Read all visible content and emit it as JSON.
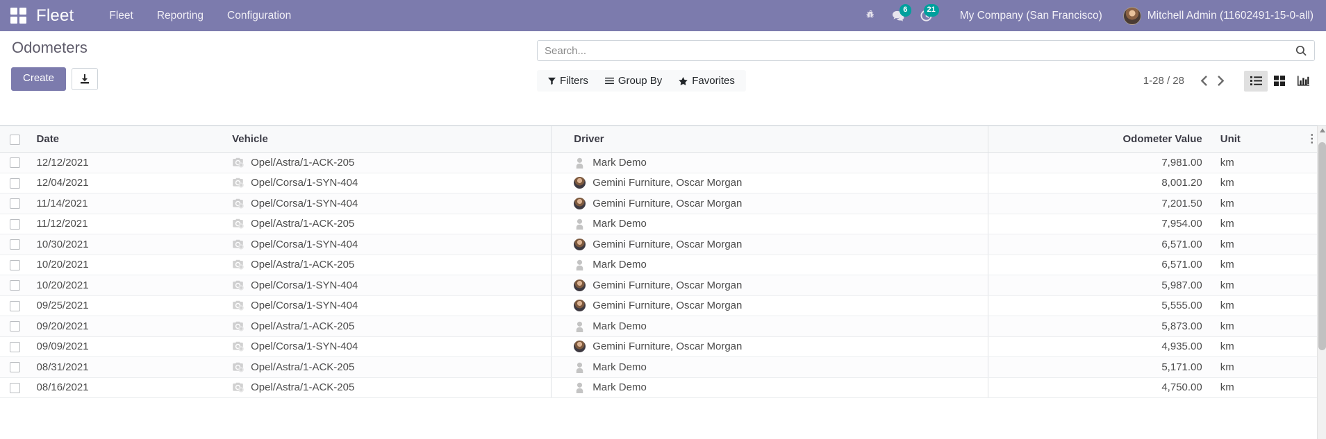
{
  "navbar": {
    "apps_icon": "apps-grid-icon",
    "brand": "Fleet",
    "menus": [
      {
        "label": "Fleet"
      },
      {
        "label": "Reporting"
      },
      {
        "label": "Configuration"
      }
    ],
    "sys_icons": [
      {
        "name": "bug-icon",
        "badge": null
      },
      {
        "name": "messages-icon",
        "badge": "6"
      },
      {
        "name": "activities-clock-icon",
        "badge": "21"
      }
    ],
    "company": "My Company (San Francisco)",
    "user": "Mitchell Admin (11602491-15-0-all)"
  },
  "control_panel": {
    "title": "Odometers",
    "create_label": "Create",
    "import_icon": "import-download-icon",
    "search": {
      "placeholder": "Search...",
      "value": "",
      "icon": "search-icon"
    },
    "filters": [
      {
        "name": "filters",
        "label": "Filters",
        "icon": "funnel-icon"
      },
      {
        "name": "group-by",
        "label": "Group By",
        "icon": "bars-icon"
      },
      {
        "name": "favorites",
        "label": "Favorites",
        "icon": "star-icon"
      }
    ],
    "pager": {
      "range": "1-28 / 28",
      "prev_icon": "chevron-left-icon",
      "next_icon": "chevron-right-icon"
    },
    "views": [
      {
        "name": "list",
        "icon": "list-view-icon",
        "active": true
      },
      {
        "name": "kanban",
        "icon": "kanban-view-icon",
        "active": false
      },
      {
        "name": "graph",
        "icon": "graph-view-icon",
        "active": false
      }
    ]
  },
  "table": {
    "columns": {
      "date": "Date",
      "vehicle": "Vehicle",
      "driver": "Driver",
      "odometer_value": "Odometer Value",
      "unit": "Unit",
      "options_icon": "vertical-dots-icon"
    },
    "rows": [
      {
        "date": "12/12/2021",
        "vehicle": "Opel/Astra/1-ACK-205",
        "driver": "Mark Demo",
        "driver_avatar": "anon",
        "odometer_value": "7,981.00",
        "unit": "km"
      },
      {
        "date": "12/04/2021",
        "vehicle": "Opel/Corsa/1-SYN-404",
        "driver": "Gemini Furniture, Oscar Morgan",
        "driver_avatar": "photo",
        "odometer_value": "8,001.20",
        "unit": "km"
      },
      {
        "date": "11/14/2021",
        "vehicle": "Opel/Corsa/1-SYN-404",
        "driver": "Gemini Furniture, Oscar Morgan",
        "driver_avatar": "photo",
        "odometer_value": "7,201.50",
        "unit": "km"
      },
      {
        "date": "11/12/2021",
        "vehicle": "Opel/Astra/1-ACK-205",
        "driver": "Mark Demo",
        "driver_avatar": "anon",
        "odometer_value": "7,954.00",
        "unit": "km"
      },
      {
        "date": "10/30/2021",
        "vehicle": "Opel/Corsa/1-SYN-404",
        "driver": "Gemini Furniture, Oscar Morgan",
        "driver_avatar": "photo",
        "odometer_value": "6,571.00",
        "unit": "km"
      },
      {
        "date": "10/20/2021",
        "vehicle": "Opel/Astra/1-ACK-205",
        "driver": "Mark Demo",
        "driver_avatar": "anon",
        "odometer_value": "6,571.00",
        "unit": "km"
      },
      {
        "date": "10/20/2021",
        "vehicle": "Opel/Corsa/1-SYN-404",
        "driver": "Gemini Furniture, Oscar Morgan",
        "driver_avatar": "photo",
        "odometer_value": "5,987.00",
        "unit": "km"
      },
      {
        "date": "09/25/2021",
        "vehicle": "Opel/Corsa/1-SYN-404",
        "driver": "Gemini Furniture, Oscar Morgan",
        "driver_avatar": "photo",
        "odometer_value": "5,555.00",
        "unit": "km"
      },
      {
        "date": "09/20/2021",
        "vehicle": "Opel/Astra/1-ACK-205",
        "driver": "Mark Demo",
        "driver_avatar": "anon",
        "odometer_value": "5,873.00",
        "unit": "km"
      },
      {
        "date": "09/09/2021",
        "vehicle": "Opel/Corsa/1-SYN-404",
        "driver": "Gemini Furniture, Oscar Morgan",
        "driver_avatar": "photo",
        "odometer_value": "4,935.00",
        "unit": "km"
      },
      {
        "date": "08/31/2021",
        "vehicle": "Opel/Astra/1-ACK-205",
        "driver": "Mark Demo",
        "driver_avatar": "anon",
        "odometer_value": "5,171.00",
        "unit": "km"
      },
      {
        "date": "08/16/2021",
        "vehicle": "Opel/Astra/1-ACK-205",
        "driver": "Mark Demo",
        "driver_avatar": "anon",
        "odometer_value": "4,750.00",
        "unit": "km"
      }
    ]
  },
  "colors": {
    "brand_purple": "#7C7BAD",
    "badge_teal": "#00A09D",
    "text_dark": "#4c4c4c"
  }
}
